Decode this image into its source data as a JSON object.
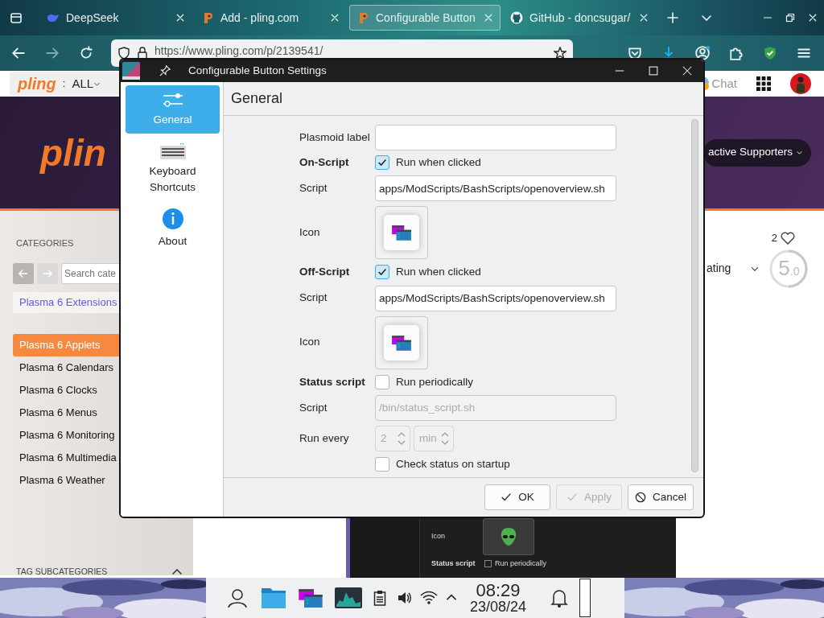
{
  "browser": {
    "tabs": [
      {
        "title": "DeepSeek",
        "kind": "whale",
        "selected": false
      },
      {
        "title": "Add - pling.com",
        "kind": "pling",
        "selected": false
      },
      {
        "title": "Configurable Button",
        "kind": "pling",
        "selected": true
      },
      {
        "title": "GitHub - doncsugar/",
        "kind": "github",
        "selected": false
      }
    ],
    "url": "https://www.pling.com/p/2139541/",
    "page": {
      "header": {
        "logo": "pling",
        "separator": ":",
        "section": "ALL",
        "chat": "Chat"
      },
      "banner": {
        "logo": "plin",
        "supporters": "active Supporters"
      },
      "categories": {
        "heading": "CATEGORIES",
        "search_placeholder": "Search cate",
        "parent": "Plasma 6 Extensions",
        "items": [
          {
            "label": "Plasma 6 Applets",
            "selected": true
          },
          {
            "label": "Plasma 6 Calendars",
            "selected": false
          },
          {
            "label": "Plasma 6 Clocks",
            "selected": false
          },
          {
            "label": "Plasma 6 Menus",
            "selected": false
          },
          {
            "label": "Plasma 6 Monitoring",
            "selected": false
          },
          {
            "label": "Plasma 6 Multimedia",
            "selected": false
          },
          {
            "label": "Plasma 6 Weather",
            "selected": false
          }
        ]
      },
      "tag_heading": "TAG SUBCATEGORIES",
      "likes": "2",
      "sort_label": "ating",
      "score": "5",
      "score_decimal": ".0"
    }
  },
  "background_window": {
    "icon_label": "Icon",
    "status_label": "Status script",
    "checkbox_label": "Run periodically",
    "checked": false
  },
  "dialog": {
    "title": "Configurable Button Settings",
    "sidebar": [
      {
        "label": "General",
        "kind": "sliders",
        "selected": true
      },
      {
        "label": "Keyboard Shortcuts",
        "kind": "keyboard",
        "selected": false
      },
      {
        "label": "About",
        "kind": "info",
        "selected": false
      }
    ],
    "heading": "General",
    "rows": [
      {
        "kind": "text",
        "label": "Plasmoid label",
        "disabled": false
      },
      {
        "kind": "check",
        "label": "On-Script",
        "text": "Run when clicked",
        "checked": true
      },
      {
        "kind": "text",
        "label": "Script",
        "value": "apps/ModScripts/BashScripts/openoverview.sh",
        "disabled": false
      },
      {
        "kind": "icon",
        "label": "Icon"
      },
      {
        "kind": "check",
        "label": "Off-Script",
        "text": "Run when clicked",
        "checked": true
      },
      {
        "kind": "text",
        "label": "Script",
        "value": "apps/ModScripts/BashScripts/openoverview.sh",
        "disabled": false
      },
      {
        "kind": "icon",
        "label": "Icon"
      },
      {
        "kind": "check",
        "label": "Status script",
        "text": "Run periodically",
        "checked": false
      },
      {
        "kind": "text",
        "label": "Script",
        "placeholder": "/bin/status_script.sh",
        "disabled": true
      },
      {
        "kind": "spin",
        "label": "Run every",
        "value": "2",
        "unit": "min",
        "disabled": true
      },
      {
        "kind": "check",
        "text": "Check status on startup",
        "checked": false
      }
    ],
    "buttons": [
      {
        "label": "OK",
        "kind": "ok",
        "disabled": false
      },
      {
        "label": "Apply",
        "kind": "ok",
        "disabled": true
      },
      {
        "label": "Cancel",
        "kind": "cancel",
        "disabled": false
      }
    ]
  },
  "taskbar": {
    "time": "08:29",
    "date": "23/08/24"
  }
}
